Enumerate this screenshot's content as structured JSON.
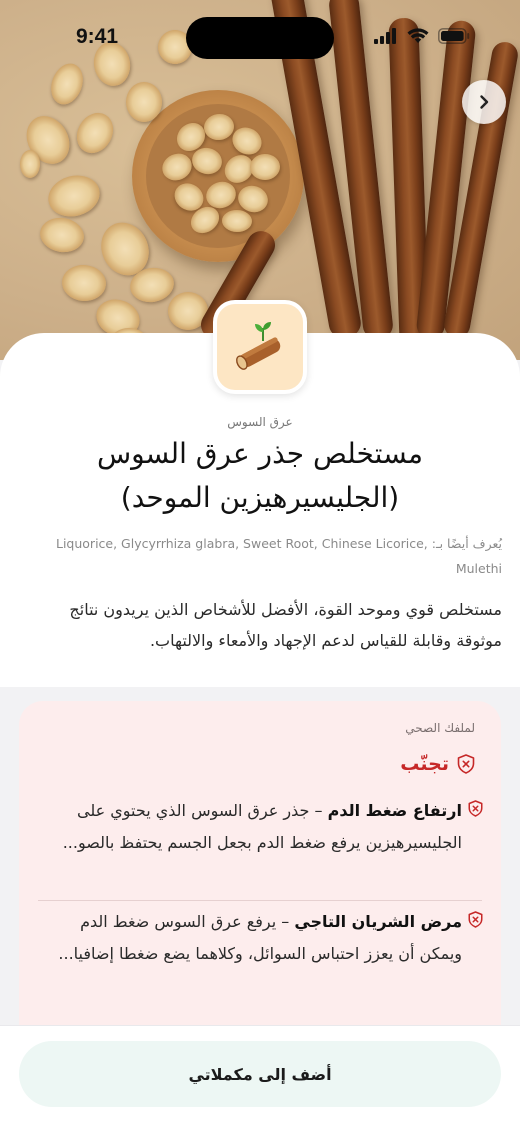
{
  "status_bar": {
    "time": "9:41"
  },
  "hero": {
    "next_button_icon": "chevron-right-icon"
  },
  "product": {
    "category": "عرق السوس",
    "title": "مستخلص جذر عرق السوس (الجليسيرهيزين الموحد)",
    "aka_prefix": "يُعرف أيضًا بـ:",
    "aka_names": "Liquorice, Glycyrrhiza glabra, Sweet Root, Chinese Licorice, Mulethi",
    "description": "مستخلص قوي وموحد القوة، الأفضل للأشخاص الذين يريدون نتائج موثوقة وقابلة للقياس لدعم الإجهاد والأمعاء والالتهاب."
  },
  "health_card": {
    "caption": "لملفك الصحي",
    "avoid_label": "تجنّب",
    "issues": [
      {
        "title": "ارتفاع ضغط الدم",
        "body": " – جذر عرق السوس الذي يحتوي على الجليسيرهيزين يرفع ضغط الدم بجعل الجسم يحتفظ بالصو..."
      },
      {
        "title": "مرض الشريان التاجي",
        "body": " – يرفع عرق السوس ضغط الدم ويمكن أن يعزز احتباس السوائل، وكلاهما يضع ضغطا إضافيا..."
      }
    ]
  },
  "bottom": {
    "add_button_label": "أضف إلى مكملاتي"
  },
  "colors": {
    "avoid_red": "#c62828",
    "card_bg": "#fdeded",
    "button_bg": "#edf7f4",
    "icon_tile_bg": "#fde6c4"
  }
}
